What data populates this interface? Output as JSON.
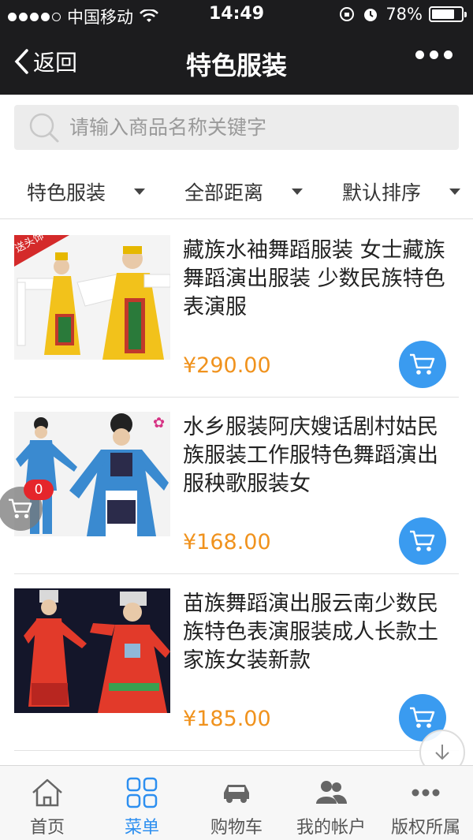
{
  "status_bar": {
    "carrier": "中国移动",
    "time": "14:49",
    "battery_text": "78%",
    "battery_level": 0.78
  },
  "nav": {
    "back_label": "返回",
    "title": "特色服装"
  },
  "search": {
    "placeholder": "请输入商品名称关键字"
  },
  "filters": [
    {
      "label": "特色服装"
    },
    {
      "label": "全部距离"
    },
    {
      "label": "默认排序"
    }
  ],
  "products": [
    {
      "title": "藏族水袖舞蹈服装 女士藏族舞蹈演出服装 少数民族特色表演服",
      "price": "¥290.00",
      "tag": "送头饰"
    },
    {
      "title": "水乡服装阿庆嫂话剧村姑民族服装工作服特色舞蹈演出服秧歌服装女",
      "price": "¥168.00"
    },
    {
      "title": "苗族舞蹈演出服云南少数民族特色表演服装成人长款土家族女装新款",
      "price": "¥185.00"
    }
  ],
  "floating_cart": {
    "count": "0"
  },
  "tab_bar": [
    {
      "label": "首页",
      "icon": "home-icon"
    },
    {
      "label": "菜单",
      "icon": "menu-grid-icon",
      "active": true
    },
    {
      "label": "购物车",
      "icon": "car-icon"
    },
    {
      "label": "我的帐户",
      "icon": "account-icon"
    },
    {
      "label": "版权所属",
      "icon": "more-dots-icon"
    }
  ],
  "colors": {
    "accent_blue": "#3a9bf0",
    "price_orange": "#f0921d",
    "header_dark": "#1c1c1e",
    "badge_red": "#e5262b"
  }
}
